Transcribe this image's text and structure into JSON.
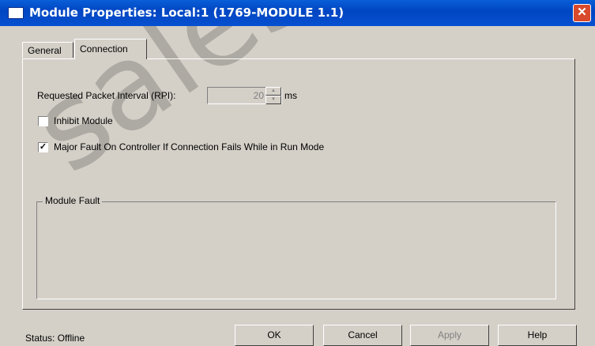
{
  "window": {
    "title": "Module Properties: Local:1 (1769-MODULE 1.1)",
    "close_glyph": "✕"
  },
  "tabs": [
    {
      "label": "General",
      "active": false
    },
    {
      "label": "Connection",
      "active": true
    }
  ],
  "connection": {
    "rpi_label": "Requested Packet Interval (RPI):",
    "rpi_value": "20",
    "rpi_unit": "ms",
    "inhibit_label": "Inhibit Module",
    "inhibit_checked": false,
    "major_fault_label": "Major Fault On Controller If Connection Fails While in Run Mode",
    "major_fault_checked": true,
    "checkmark": "✓",
    "module_fault_label": "Module Fault"
  },
  "status": {
    "text": "Status:  Offline"
  },
  "buttons": {
    "ok": "OK",
    "cancel": "Cancel",
    "apply": "Apply",
    "help": "Help"
  },
  "watermark": "sales@cam"
}
